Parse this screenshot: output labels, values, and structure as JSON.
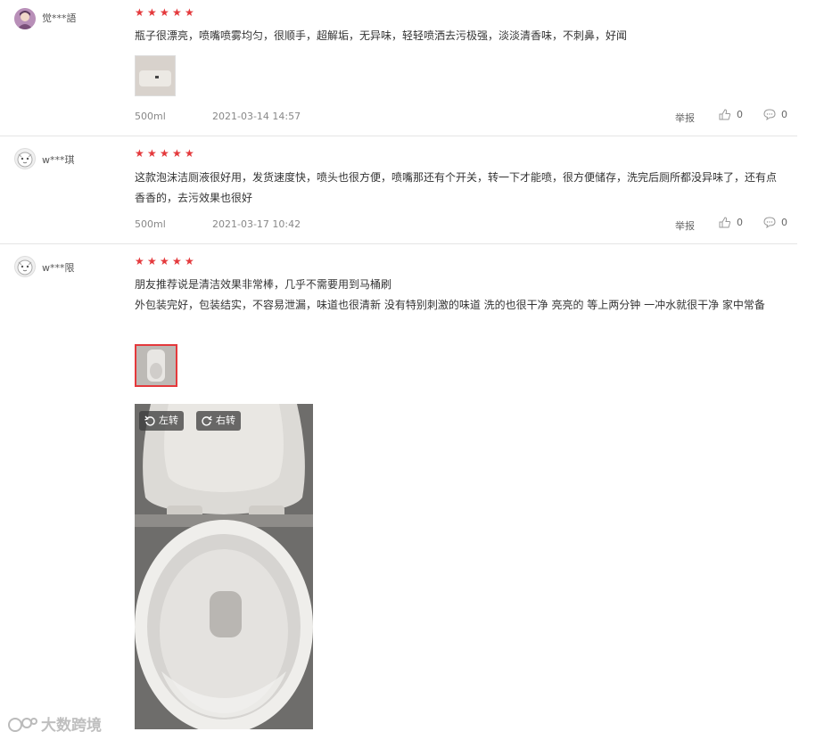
{
  "reviews": [
    {
      "user": "觉***語",
      "rating": 5,
      "text": "瓶子很漂亮，喷嘴喷雾均匀，很顺手，超解垢，无异味，轻轻喷洒去污极强，淡淡清香味，不刺鼻，好闻",
      "spec": "500ml",
      "date": "2021-03-14 14:57",
      "report": "举报",
      "likes": "0",
      "comments": "0"
    },
    {
      "user": "w***琪",
      "rating": 5,
      "text": "这款泡沫洁厕液很好用，发货速度快，喷头也很方便，喷嘴那还有个开关，转一下才能喷，很方便储存，洗完后厕所都没异味了，还有点香香的，去污效果也很好",
      "spec": "500ml",
      "date": "2021-03-17 10:42",
      "report": "举报",
      "likes": "0",
      "comments": "0"
    },
    {
      "user": "w***限",
      "rating": 5,
      "text_line1": "朋友推荐说是清洁效果非常棒，几乎不需要用到马桶刷",
      "text_line2": "外包装完好，包装结实，不容易泄漏，味道也很清新 没有特别刺激的味道 洗的也很干净 亮亮的 等上两分钟 一冲水就很干净 家中常备"
    }
  ],
  "image_viewer": {
    "rotate_left": "左转",
    "rotate_right": "右转"
  },
  "watermark": "大数跨境",
  "colors": {
    "star": "#e4393c",
    "divider": "#e5e5e5"
  }
}
